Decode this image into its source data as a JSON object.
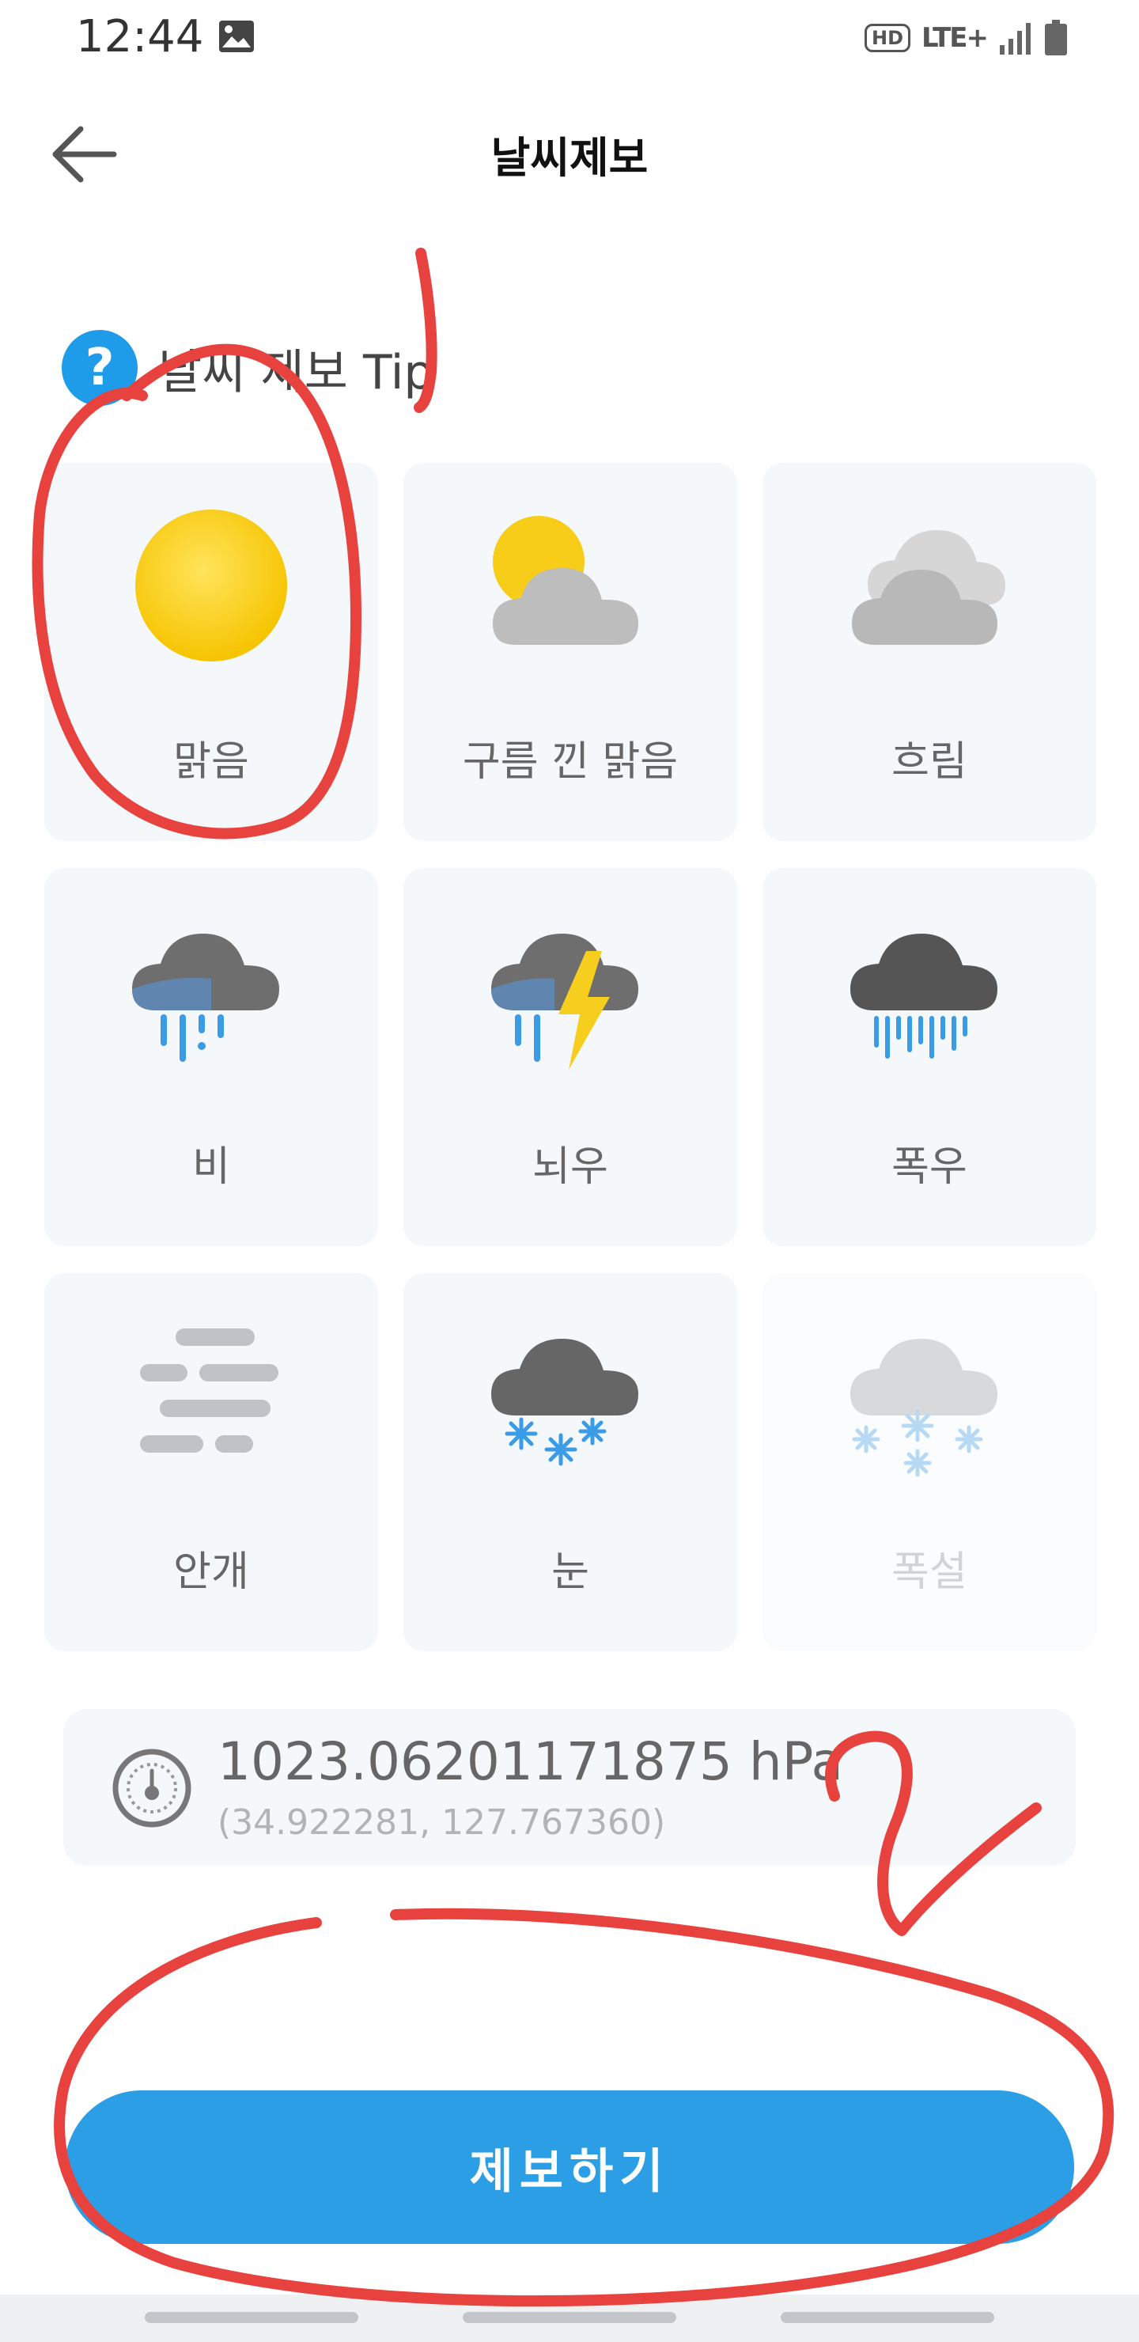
{
  "status_bar": {
    "time": "12:44",
    "hd_badge": "HD",
    "network": "LTE+",
    "icons": [
      "gallery-icon",
      "hd-voice-icon",
      "lte-plus-icon",
      "signal-icon",
      "battery-icon"
    ]
  },
  "app_bar": {
    "title": "날씨제보",
    "back_icon": "arrow-left-icon"
  },
  "tip": {
    "label": "날씨 제보 Tip",
    "icon": "question-icon"
  },
  "weather_options": [
    {
      "label": "맑음",
      "icon": "sun-icon",
      "enabled": true
    },
    {
      "label": "구름 낀 맑음",
      "icon": "partly-cloudy-icon",
      "enabled": true
    },
    {
      "label": "흐림",
      "icon": "cloudy-icon",
      "enabled": true
    },
    {
      "label": "비",
      "icon": "rain-icon",
      "enabled": true
    },
    {
      "label": "뇌우",
      "icon": "thunderstorm-icon",
      "enabled": true
    },
    {
      "label": "폭우",
      "icon": "heavy-rain-icon",
      "enabled": true
    },
    {
      "label": "안개",
      "icon": "fog-icon",
      "enabled": true
    },
    {
      "label": "눈",
      "icon": "snow-icon",
      "enabled": true
    },
    {
      "label": "폭설",
      "icon": "heavy-snow-icon",
      "enabled": false
    }
  ],
  "pressure": {
    "value": "1023.06201171875 hPa",
    "coords": "(34.922281, 127.767360)",
    "icon": "gauge-icon"
  },
  "submit": {
    "label": "제보하기"
  },
  "colors": {
    "accent": "#2b9ee6",
    "card_bg": "#f5f8fa",
    "annotation": "#e8423f"
  }
}
